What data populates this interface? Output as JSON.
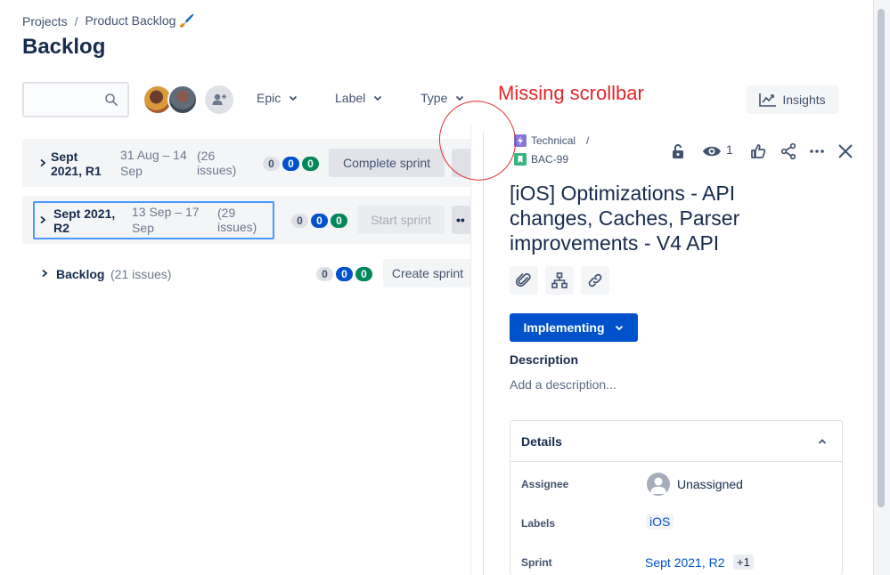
{
  "breadcrumb": {
    "projects": "Projects",
    "separator": "/",
    "project": "Product Backlog 🖌️"
  },
  "title": "Backlog",
  "search": {
    "value": "",
    "placeholder": ""
  },
  "filters": {
    "epic": "Epic",
    "label": "Label",
    "type": "Type"
  },
  "insights_label": "Insights",
  "annotation": "Missing scrollbar",
  "sprints": [
    {
      "name_line1": "Sept",
      "name_line2": "2021, R1",
      "dates_line1": "31 Aug – 14",
      "dates_line2": "Sep",
      "count_line1": "(26",
      "count_line2": "issues)",
      "todo": "0",
      "inprogress": "0",
      "done": "0",
      "action": "Complete sprint"
    },
    {
      "name_line1": "Sept 2021,",
      "name_line2": "R2",
      "dates_line1": "13 Sep – 17",
      "dates_line2": "Sep",
      "count_line1": "(29",
      "count_line2": "issues)",
      "todo": "0",
      "inprogress": "0",
      "done": "0",
      "action": "Start sprint",
      "more": "••"
    }
  ],
  "backlog": {
    "name": "Backlog",
    "count": "(21 issues)",
    "todo": "0",
    "inprogress": "0",
    "done": "0",
    "action": "Create sprint"
  },
  "issue": {
    "parent": "Technical",
    "parent_sep": "/",
    "key": "BAC-99",
    "watchers": "1",
    "title": "[iOS] Optimizations - API changes, Caches, Parser improvements - V4 API",
    "status": "Implementing",
    "description_label": "Description",
    "description_placeholder": "Add a description...",
    "details": {
      "title": "Details",
      "assignee_label": "Assignee",
      "assignee_value": "Unassigned",
      "labels_label": "Labels",
      "labels_value": "iOS",
      "sprint_label": "Sprint",
      "sprint_value": "Sept 2021, R2",
      "sprint_extra": "+1"
    }
  },
  "colors": {
    "primary": "#0052CC",
    "success": "#00875A",
    "annotation": "#E3262A",
    "focus": "#4C9AFF"
  }
}
